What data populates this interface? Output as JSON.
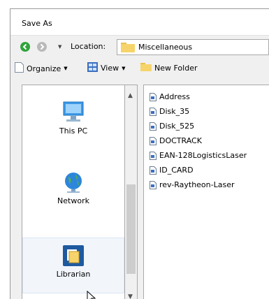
{
  "window": {
    "title": "Save As"
  },
  "location": {
    "label": "Location:",
    "value": "Miscellaneous"
  },
  "toolbar": {
    "organize": "Organize",
    "view": "View",
    "new_folder": "New Folder"
  },
  "places": [
    {
      "label": "This PC",
      "icon": "computer-icon"
    },
    {
      "label": "Network",
      "icon": "network-globe-icon"
    },
    {
      "label": "Librarian",
      "icon": "librarian-icon",
      "selected": true
    }
  ],
  "files": [
    "Address",
    "Disk_35",
    "Disk_525",
    "DOCTRACK",
    "EAN-128LogisticsLaser",
    "ID_CARD",
    "rev-Raytheon-Laser"
  ],
  "colors": {
    "back_button": "#2fa43a",
    "forward_button": "#b9b9b9",
    "folder": "#f6d46b",
    "librarian_tile": "#1e5aa0"
  }
}
